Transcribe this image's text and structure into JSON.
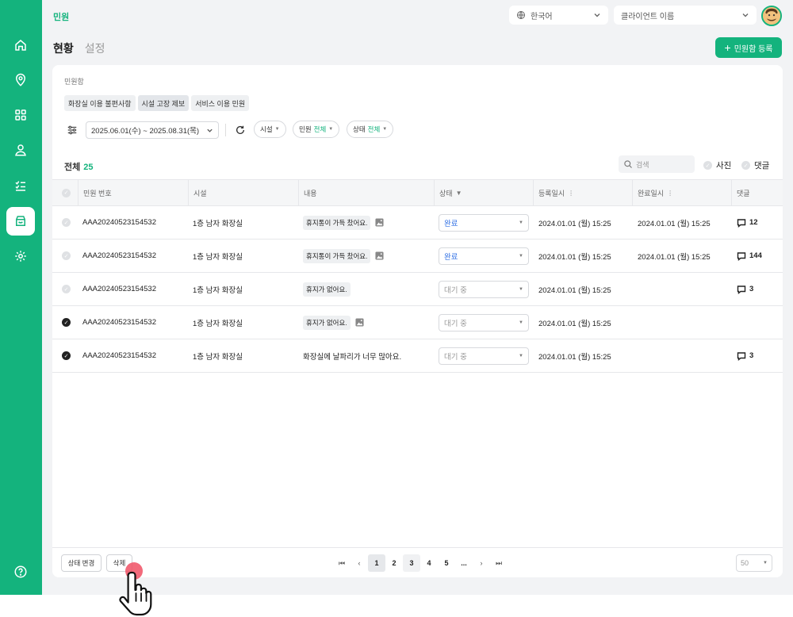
{
  "header": {
    "brand": "민원",
    "language": "한국어",
    "client_placeholder": "클라이언트 이름"
  },
  "tabs": [
    {
      "label": "현황",
      "active": true
    },
    {
      "label": "설정",
      "active": false
    }
  ],
  "register_button": "민원함 등록",
  "box": {
    "label": "민원함",
    "categories": [
      "화장실 이용 불편사항",
      "시설 고장 제보",
      "서비스 이용 민원"
    ],
    "selected_category": "시설 고장 제보"
  },
  "filters": {
    "date_range": "2025.06.01(수) ~ 2025.08.31(목)",
    "facility": "시설",
    "complaint_label": "민원",
    "complaint_value": "전체",
    "status_label": "상태",
    "status_value": "전체"
  },
  "summary": {
    "total_label": "전체",
    "total_count": "25",
    "search_placeholder": "검색",
    "photo_label": "사진",
    "comment_label": "댓글"
  },
  "table": {
    "columns": [
      "민원 번호",
      "시설",
      "내용",
      "상태",
      "등록일시",
      "완료일시",
      "댓글"
    ],
    "rows": [
      {
        "checked": false,
        "id": "AAA20240523154532",
        "facility": "1층 남자 화장실",
        "content": "휴지통이 가득 찼어요.",
        "content_tag": true,
        "has_image": true,
        "status": "완료",
        "status_type": "done",
        "registered": "2024.01.01 (월) 15:25",
        "completed": "2024.01.01 (월) 15:25",
        "comments": "12"
      },
      {
        "checked": false,
        "id": "AAA20240523154532",
        "facility": "1층 남자 화장실",
        "content": "휴지통이 가득 찼어요.",
        "content_tag": true,
        "has_image": true,
        "status": "완료",
        "status_type": "done",
        "registered": "2024.01.01 (월) 15:25",
        "completed": "2024.01.01 (월) 15:25",
        "comments": "144"
      },
      {
        "checked": false,
        "id": "AAA20240523154532",
        "facility": "1층 남자 화장실",
        "content": "휴지가 없어요.",
        "content_tag": true,
        "has_image": false,
        "status": "대기 중",
        "status_type": "wait",
        "registered": "2024.01.01 (월) 15:25",
        "completed": "",
        "comments": "3"
      },
      {
        "checked": true,
        "id": "AAA20240523154532",
        "facility": "1층 남자 화장실",
        "content": "휴지가 없어요.",
        "content_tag": true,
        "has_image": true,
        "status": "대기 중",
        "status_type": "wait",
        "registered": "2024.01.01 (월) 15:25",
        "completed": "",
        "comments": ""
      },
      {
        "checked": true,
        "id": "AAA20240523154532",
        "facility": "1층 남자 화장실",
        "content": "화장실에 날파리가 너무 많아요.",
        "content_tag": false,
        "has_image": false,
        "status": "대기 중",
        "status_type": "wait",
        "registered": "2024.01.01 (월) 15:25",
        "completed": "",
        "comments": "3"
      }
    ]
  },
  "footer": {
    "status_change": "상태 변경",
    "delete": "삭제",
    "pages": [
      "1",
      "2",
      "3",
      "4",
      "5",
      "..."
    ],
    "current_page": "1",
    "per_page": "50"
  },
  "colors": {
    "brand": "#14b37d",
    "status_done": "#2f6fe4",
    "status_wait": "#999999"
  },
  "icons": [
    "home-icon",
    "location-icon",
    "grid-icon",
    "user-icon",
    "checklist-icon",
    "inbox-icon",
    "gear-icon",
    "help-icon",
    "globe-icon",
    "filter-icon",
    "refresh-icon",
    "search-icon",
    "image-icon",
    "comment-icon",
    "pointer-hand-icon"
  ]
}
